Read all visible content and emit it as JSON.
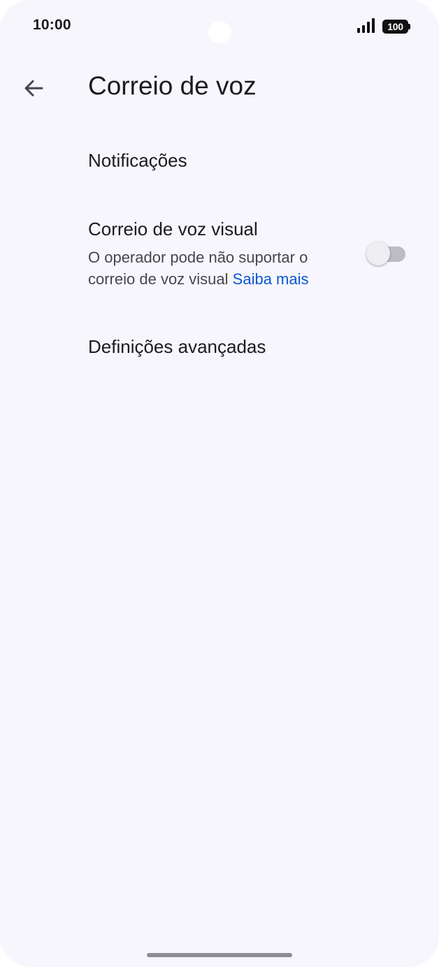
{
  "status_bar": {
    "time": "10:00",
    "battery": "100",
    "signal_icon": "cellular-signal-icon"
  },
  "app_bar": {
    "back_icon": "arrow-back-icon",
    "title": "Correio de voz"
  },
  "settings": {
    "notifications": {
      "title": "Notificações"
    },
    "visual_voicemail": {
      "title": "Correio de voz visual",
      "summary": "O operador pode não suportar o correio de voz visual",
      "link": "Saiba mais",
      "enabled": false
    },
    "advanced": {
      "title": "Definições avançadas"
    }
  },
  "colors": {
    "background": "#f7f6fc",
    "text_primary": "#1c1b20",
    "text_secondary": "#47464f",
    "link": "#0b57d0",
    "toggle_off_track": "#bdbcc4"
  }
}
